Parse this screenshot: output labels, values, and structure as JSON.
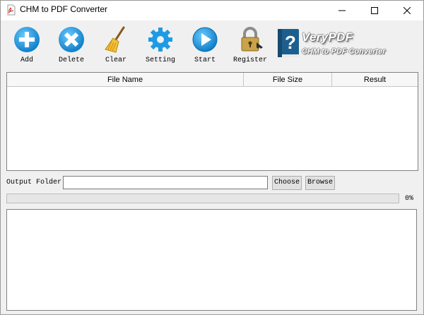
{
  "window": {
    "title": "CHM to PDF Converter"
  },
  "toolbar": {
    "items": [
      {
        "label": "Add",
        "icon": "add-icon",
        "color": "#1e9be3"
      },
      {
        "label": "Delete",
        "icon": "delete-icon",
        "color": "#1e9be3"
      },
      {
        "label": "Clear",
        "icon": "broom-icon",
        "color": "#e8b21a"
      },
      {
        "label": "Setting",
        "icon": "gear-icon",
        "color": "#1e9be3"
      },
      {
        "label": "Start",
        "icon": "play-icon",
        "color": "#1e9be3"
      },
      {
        "label": "Register",
        "icon": "padlock-icon",
        "color": "#8a8a8a"
      }
    ]
  },
  "brand": {
    "name": "VeryPDF",
    "product": "CHM to PDF Converter",
    "icon": "help-book-icon"
  },
  "file_list": {
    "columns": [
      "File Name",
      "File Size",
      "Result"
    ],
    "rows": []
  },
  "output": {
    "label": "Output Folder:",
    "value": "",
    "choose_label": "Choose",
    "browse_label": "Browse"
  },
  "progress": {
    "value": 0,
    "text": "0%"
  },
  "log": {
    "text": ""
  }
}
